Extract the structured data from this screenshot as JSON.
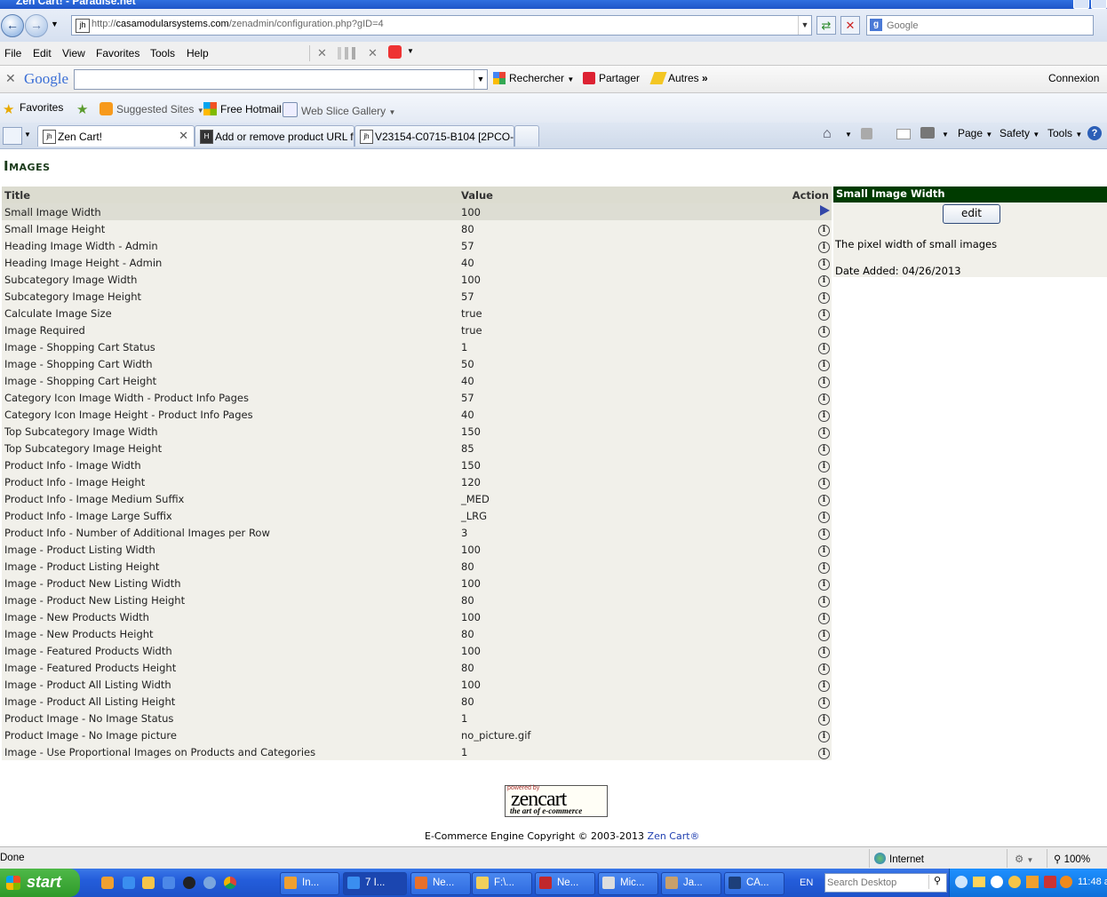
{
  "window": {
    "title": "Zen Cart! - Paradise.net"
  },
  "address": {
    "url_prefix": "http://",
    "url_domain": "casamodularsystems.com",
    "url_path": "/zenadmin/configuration.php?gID=4",
    "search_placeholder": "Google"
  },
  "menubar": {
    "items": [
      "File",
      "Edit",
      "View",
      "Favorites",
      "Tools",
      "Help"
    ]
  },
  "google_toolbar": {
    "logo": "Google",
    "search_label": "Rechercher",
    "share_label": "Partager",
    "more_label": "Autres",
    "signin_label": "Connexion"
  },
  "favorites_bar": {
    "favorites_label": "Favorites",
    "items": [
      "Suggested Sites",
      "Free Hotmail",
      "Web Slice Gallery"
    ]
  },
  "tabs": [
    {
      "label": "Zen Cart!"
    },
    {
      "label": "Add or remove product URL f..."
    },
    {
      "label": "V23154-C0715-B104 [2PCO-..."
    }
  ],
  "command_bar": {
    "page": "Page",
    "safety": "Safety",
    "tools": "Tools"
  },
  "page": {
    "heading": "Images",
    "columns": {
      "title": "Title",
      "value": "Value",
      "action": "Action"
    },
    "rows": [
      {
        "title": "Small Image Width",
        "value": "100"
      },
      {
        "title": "Small Image Height",
        "value": "80"
      },
      {
        "title": "Heading Image Width - Admin",
        "value": "57"
      },
      {
        "title": "Heading Image Height - Admin",
        "value": "40"
      },
      {
        "title": "Subcategory Image Width",
        "value": "100"
      },
      {
        "title": "Subcategory Image Height",
        "value": "57"
      },
      {
        "title": "Calculate Image Size",
        "value": "true"
      },
      {
        "title": "Image Required",
        "value": "true"
      },
      {
        "title": "Image - Shopping Cart Status",
        "value": "1"
      },
      {
        "title": "Image - Shopping Cart Width",
        "value": "50"
      },
      {
        "title": "Image - Shopping Cart Height",
        "value": "40"
      },
      {
        "title": "Category Icon Image Width - Product Info Pages",
        "value": "57"
      },
      {
        "title": "Category Icon Image Height - Product Info Pages",
        "value": "40"
      },
      {
        "title": "Top Subcategory Image Width",
        "value": "150"
      },
      {
        "title": "Top Subcategory Image Height",
        "value": "85"
      },
      {
        "title": "Product Info - Image Width",
        "value": "150"
      },
      {
        "title": "Product Info - Image Height",
        "value": "120"
      },
      {
        "title": "Product Info - Image Medium Suffix",
        "value": "_MED"
      },
      {
        "title": "Product Info - Image Large Suffix",
        "value": "_LRG"
      },
      {
        "title": "Product Info - Number of Additional Images per Row",
        "value": "3"
      },
      {
        "title": "Image - Product Listing Width",
        "value": "100"
      },
      {
        "title": "Image - Product Listing Height",
        "value": "80"
      },
      {
        "title": "Image - Product New Listing Width",
        "value": "100"
      },
      {
        "title": "Image - Product New Listing Height",
        "value": "80"
      },
      {
        "title": "Image - New Products Width",
        "value": "100"
      },
      {
        "title": "Image - New Products Height",
        "value": "80"
      },
      {
        "title": "Image - Featured Products Width",
        "value": "100"
      },
      {
        "title": "Image - Featured Products Height",
        "value": "80"
      },
      {
        "title": "Image - Product All Listing Width",
        "value": "100"
      },
      {
        "title": "Image - Product All Listing Height",
        "value": "80"
      },
      {
        "title": "Product Image - No Image Status",
        "value": "1"
      },
      {
        "title": "Product Image - No Image picture",
        "value": "no_picture.gif"
      },
      {
        "title": "Image - Use Proportional Images on Products and Categories",
        "value": "1"
      }
    ],
    "selected_index": 0,
    "infobox": {
      "heading": "Small Image Width",
      "edit_label": "edit",
      "description": "The pixel width of small images",
      "date_added": "Date Added: 04/26/2013"
    },
    "logo": {
      "powered": "powered by",
      "name": "zencart",
      "slogan": "the art of e-commerce"
    },
    "copyright": "E-Commerce Engine Copyright © 2003-2013",
    "copyright_link": "Zen Cart®"
  },
  "status_bar": {
    "left": "Done",
    "zone": "Internet",
    "zoom": "100%"
  },
  "taskbar": {
    "start_label": "start",
    "tasks": [
      "In...",
      "7 I...",
      "Ne...",
      "F:\\...",
      "Ne...",
      "Mic...",
      "Ja...",
      "CA..."
    ],
    "lang": "EN",
    "search_placeholder": "Search Desktop",
    "clock": "11:48 a"
  }
}
